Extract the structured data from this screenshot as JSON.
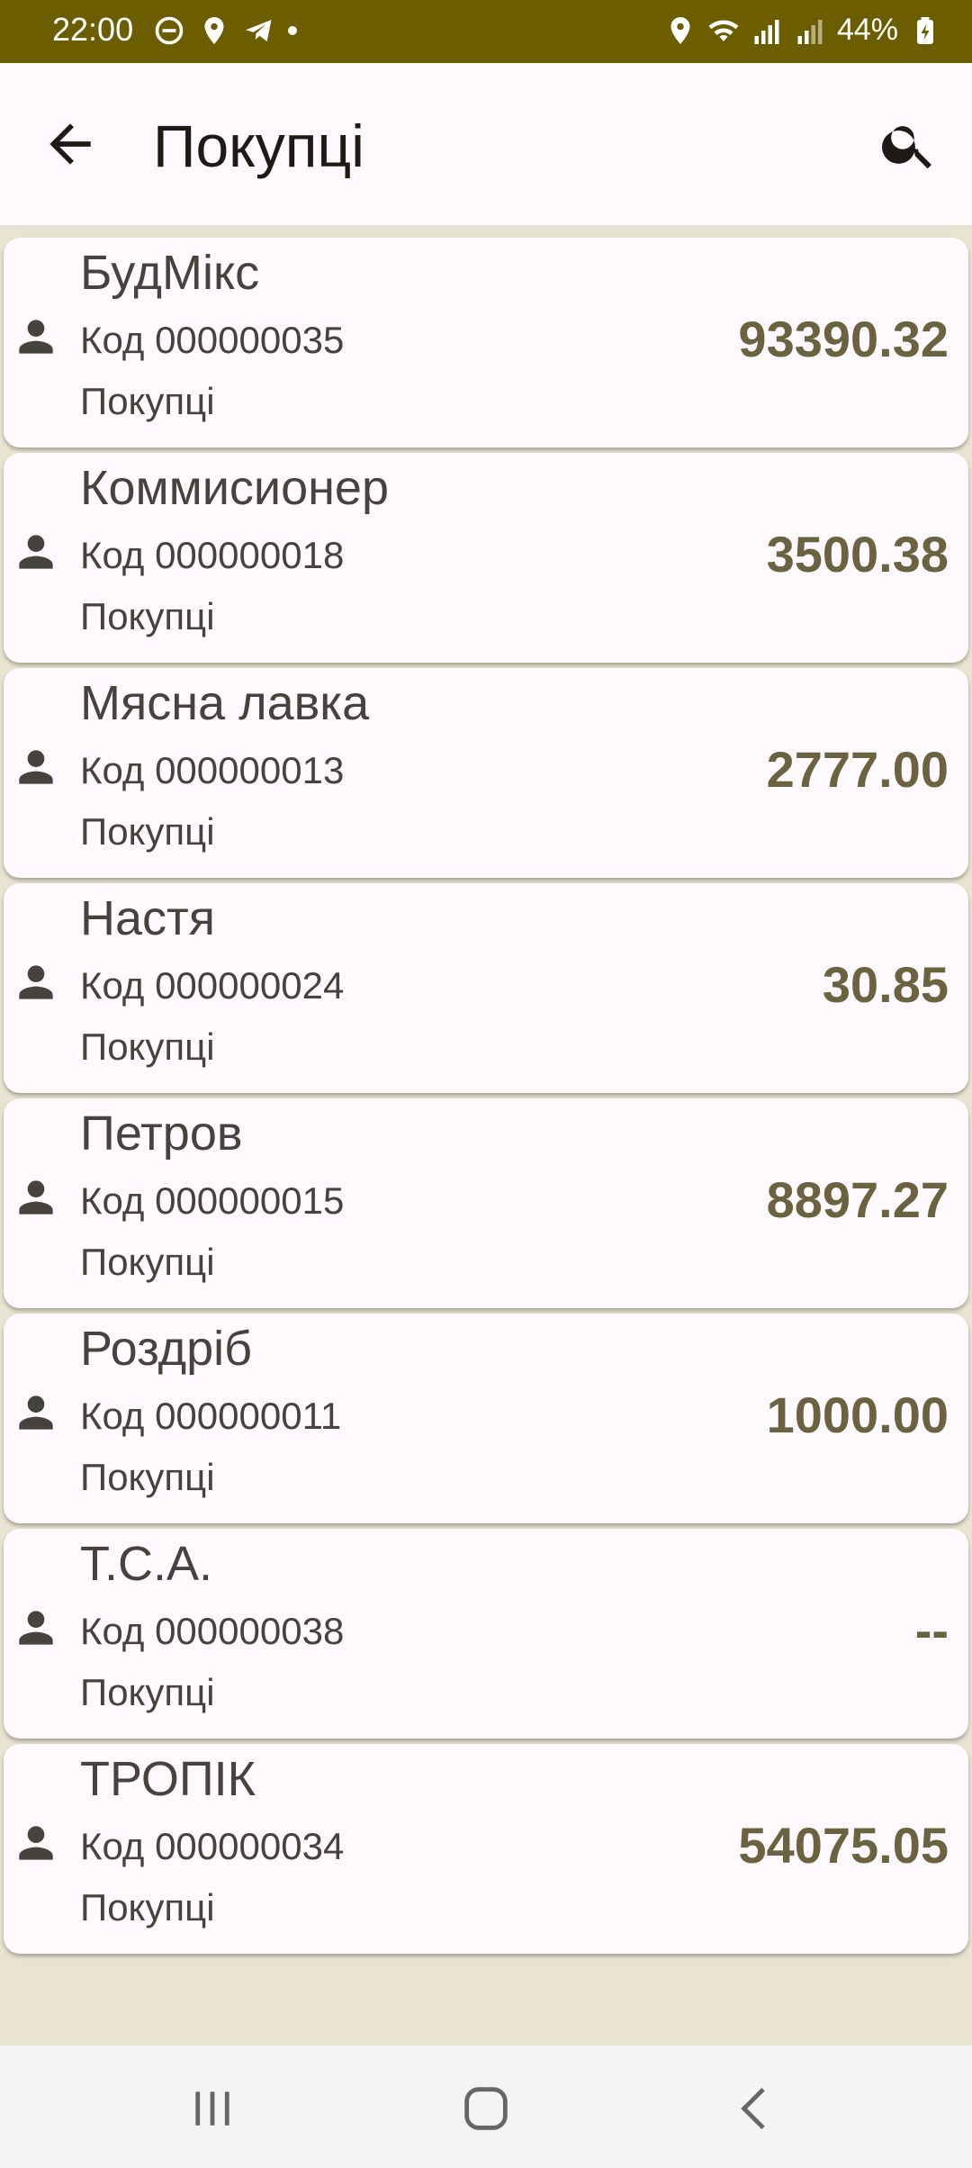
{
  "status": {
    "time": "22:00",
    "battery": "44%"
  },
  "header": {
    "title": "Покупці"
  },
  "icons": {
    "back": "arrow-back-icon",
    "search": "search-icon",
    "person": "person-icon"
  },
  "items": [
    {
      "name": "БудМікс",
      "code": "Код 000000035",
      "group": "Покупці",
      "amount": "93390.32"
    },
    {
      "name": "Коммисионер",
      "code": "Код 000000018",
      "group": "Покупці",
      "amount": "3500.38"
    },
    {
      "name": "Мясна лавка",
      "code": "Код 000000013",
      "group": "Покупці",
      "amount": "2777.00"
    },
    {
      "name": "Настя",
      "code": "Код 000000024",
      "group": "Покупці",
      "amount": "30.85"
    },
    {
      "name": "Петров",
      "code": "Код 000000015",
      "group": "Покупці",
      "amount": "8897.27"
    },
    {
      "name": "Роздріб",
      "code": "Код 000000011",
      "group": "Покупці",
      "amount": "1000.00"
    },
    {
      "name": "Т.С.А.",
      "code": "Код 000000038",
      "group": "Покупці",
      "amount": "--"
    },
    {
      "name": "ТРОПІК",
      "code": "Код 000000034",
      "group": "Покупці",
      "amount": "54075.05"
    }
  ],
  "colors": {
    "status_bar": "#6B5D00",
    "amount": "#6B6340",
    "background": "#E9E3D1"
  }
}
